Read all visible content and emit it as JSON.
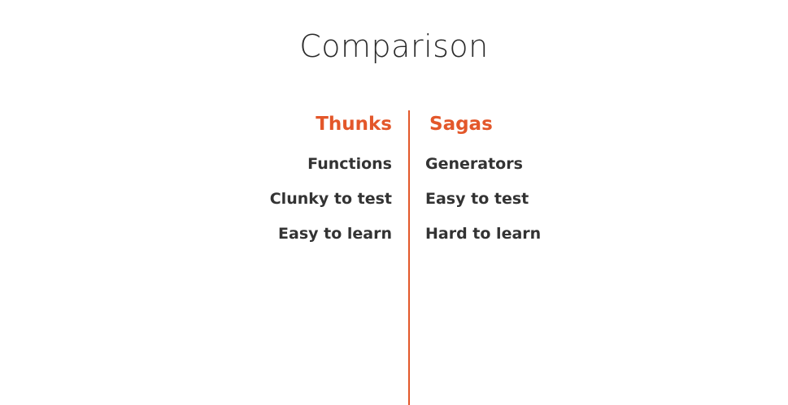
{
  "slide": {
    "title": "Comparison"
  },
  "colors": {
    "accent": "#e3572a",
    "text": "#333333",
    "background": "#ffffff"
  },
  "left_column": {
    "heading": "Thunks",
    "items": [
      "Functions",
      "Clunky to test",
      "Easy to learn"
    ]
  },
  "right_column": {
    "heading": "Sagas",
    "items": [
      "Generators",
      "Easy to test",
      "Hard to learn"
    ]
  }
}
